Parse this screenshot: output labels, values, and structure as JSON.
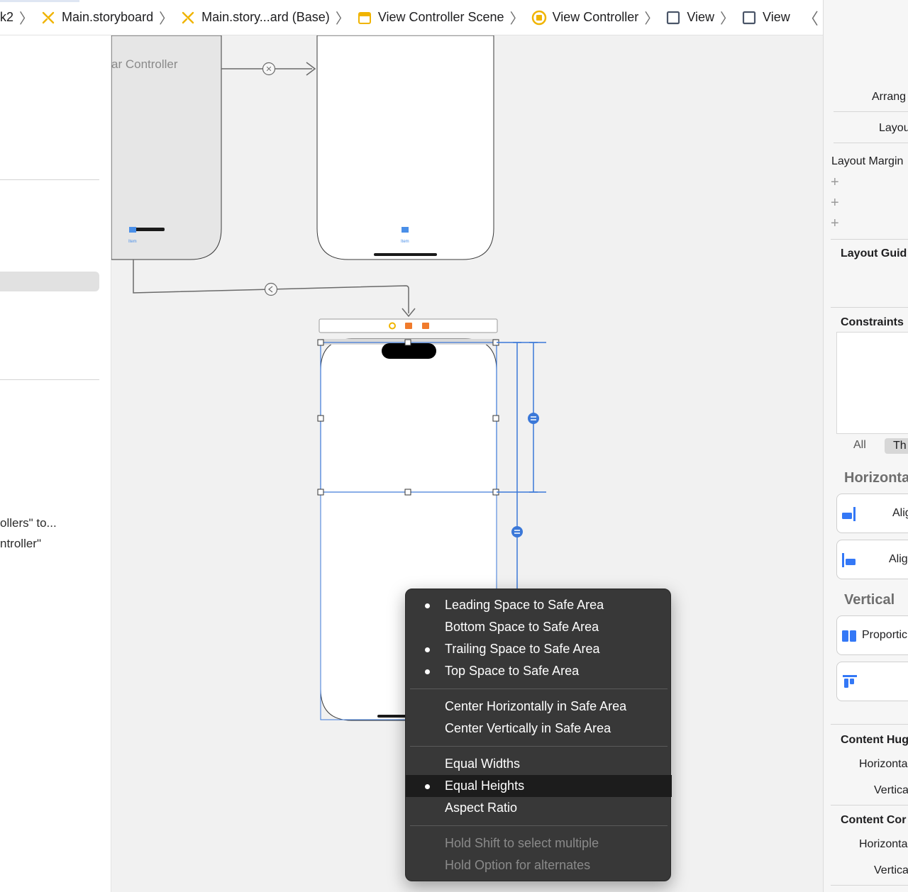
{
  "jumpbar": {
    "crumbs": [
      "k2",
      "Main.storyboard",
      "Main.story...ard (Base)",
      "View Controller Scene",
      "View Controller",
      "View",
      "View"
    ],
    "warning_icon": "warning-triangle-icon"
  },
  "left_panel": {
    "line1": "ollers\" to...",
    "line2": "ntroller\""
  },
  "canvas": {
    "tab_bar_controller_label": "ar Controller",
    "tab_item_label_1": "Item",
    "tab_item_label_2": "Item"
  },
  "menu": {
    "items": [
      {
        "label": "Leading Space to Safe Area",
        "checked": true
      },
      {
        "label": "Bottom Space to Safe Area",
        "checked": false
      },
      {
        "label": "Trailing Space to Safe Area",
        "checked": true
      },
      {
        "label": "Top Space to Safe Area",
        "checked": true
      },
      {
        "label": "Center Horizontally in Safe Area",
        "checked": false
      },
      {
        "label": "Center Vertically in Safe Area",
        "checked": false
      },
      {
        "label": "Equal Widths",
        "checked": false
      },
      {
        "label": "Equal Heights",
        "checked": true,
        "highlighted": true
      },
      {
        "label": "Aspect Ratio",
        "checked": false
      }
    ],
    "hints": [
      "Hold Shift to select multiple",
      "Hold Option for alternates"
    ]
  },
  "inspector": {
    "arrange": "Arrang",
    "layout": "Layou",
    "layout_margins": "Layout Margin",
    "layout_guides": "Layout Guid",
    "constraints": "Constraints",
    "seg_all": "All",
    "seg_this": "Th",
    "horizontal_header": "Horizonta",
    "align1": "Alig",
    "align2": "Alig",
    "vertical_header": "Vertical",
    "proportional": "Proportic",
    "content_hugging": "Content Hug",
    "hug_horizontal": "Horizonta",
    "hug_vertical": "Vertica",
    "content_compression": "Content Cor",
    "comp_horizontal": "Horizonta",
    "comp_vertical": "Vertica"
  },
  "colors": {
    "accent": "#3b78d8",
    "storyboard_icon": "#f0b400",
    "menu_bg": "#383838",
    "menu_highlight": "#1c1c1c",
    "canvas_bg": "#f1f1f1"
  }
}
